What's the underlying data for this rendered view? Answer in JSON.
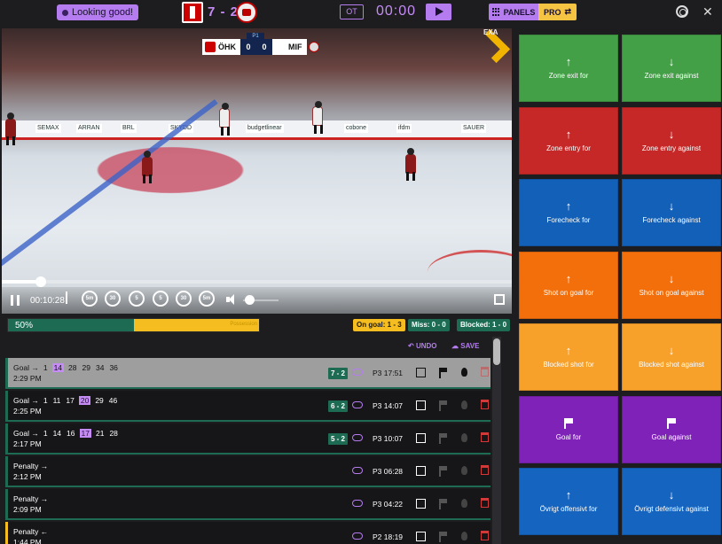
{
  "topbar": {
    "status": "Looking good!",
    "score": "7 - 2",
    "ot_label": "OT",
    "clock": "00:00",
    "panels_label": "PANELS",
    "pro_label": "PRO",
    "close": "✕"
  },
  "video": {
    "scorebug": {
      "home_team": "ÖHK",
      "home_score": "0",
      "away_score": "0",
      "away_team": "MIF",
      "period": "P1"
    },
    "corner_logo_text": "EXA",
    "ads": [
      "SEMAX",
      "ARRAN",
      "BRL",
      "SKYDD",
      "budgetlinear",
      "cobone",
      "ifdm",
      "SAUER"
    ],
    "timecode": "00:10:28",
    "skip_back_labels": [
      "5m",
      "30",
      "5"
    ],
    "skip_forward_labels": [
      "5",
      "30",
      "5m"
    ]
  },
  "stats": {
    "possession_label": "50%",
    "possession_fraction": 0.5,
    "possession_right_label": "Possession",
    "on_goal": "On goal: 1 - 3",
    "miss": "Miss: 0 - 0",
    "blocked": "Blocked: 1 - 0"
  },
  "events_toolbar": {
    "undo": "UNDO",
    "save": "SAVE"
  },
  "events": [
    {
      "type": "Goal →",
      "players": [
        "1",
        "14",
        "28",
        "29",
        "34",
        "36"
      ],
      "highlight": "14",
      "time": "2:29 PM",
      "score": "7 - 2",
      "period": "P3 17:51",
      "selected": true
    },
    {
      "type": "Goal →",
      "players": [
        "1",
        "11",
        "17",
        "20",
        "29",
        "46"
      ],
      "highlight": "20",
      "time": "2:25 PM",
      "score": "6 - 2",
      "period": "P3 14:07"
    },
    {
      "type": "Goal →",
      "players": [
        "1",
        "14",
        "16",
        "17",
        "21",
        "28"
      ],
      "highlight": "17",
      "time": "2:17 PM",
      "score": "5 - 2",
      "period": "P3 10:07"
    },
    {
      "type": "Penalty →",
      "players": [],
      "time": "2:12 PM",
      "period": "P3 06:28"
    },
    {
      "type": "Penalty →",
      "players": [],
      "time": "2:09 PM",
      "period": "P3 04:22"
    },
    {
      "type": "Penalty ←",
      "players": [],
      "time": "1:44 PM",
      "period": "P2 18:19",
      "away": true
    }
  ],
  "tiles": [
    {
      "label": "Zone exit for",
      "icon": "arrow-up-icon",
      "color": "#43a047"
    },
    {
      "label": "Zone exit against",
      "icon": "arrow-down-icon",
      "color": "#43a047"
    },
    {
      "label": "Zone entry for",
      "icon": "arrow-up-icon",
      "color": "#c62828"
    },
    {
      "label": "Zone entry against",
      "icon": "arrow-down-icon",
      "color": "#c62828"
    },
    {
      "label": "Forecheck for",
      "icon": "arrow-up-icon",
      "color": "#1360b8"
    },
    {
      "label": "Forecheck against",
      "icon": "arrow-down-icon",
      "color": "#1360b8"
    },
    {
      "label": "Shot on goal for",
      "icon": "arrow-up-icon",
      "color": "#f26f0c"
    },
    {
      "label": "Shot on goal against",
      "icon": "arrow-down-icon",
      "color": "#f26f0c"
    },
    {
      "label": "Blocked shot for",
      "icon": "arrow-up-icon",
      "color": "#f7a02a"
    },
    {
      "label": "Blocked shot against",
      "icon": "arrow-down-icon",
      "color": "#f7a02a"
    },
    {
      "label": "Goal for",
      "icon": "flag-icon",
      "color": "#7e22b8"
    },
    {
      "label": "Goal against",
      "icon": "flag-icon",
      "color": "#7e22b8"
    },
    {
      "label": "Övrigt offensivt for",
      "icon": "arrow-up-icon",
      "color": "#1565c0"
    },
    {
      "label": "Övrigt defensivt against",
      "icon": "arrow-down-icon",
      "color": "#1565c0"
    }
  ]
}
